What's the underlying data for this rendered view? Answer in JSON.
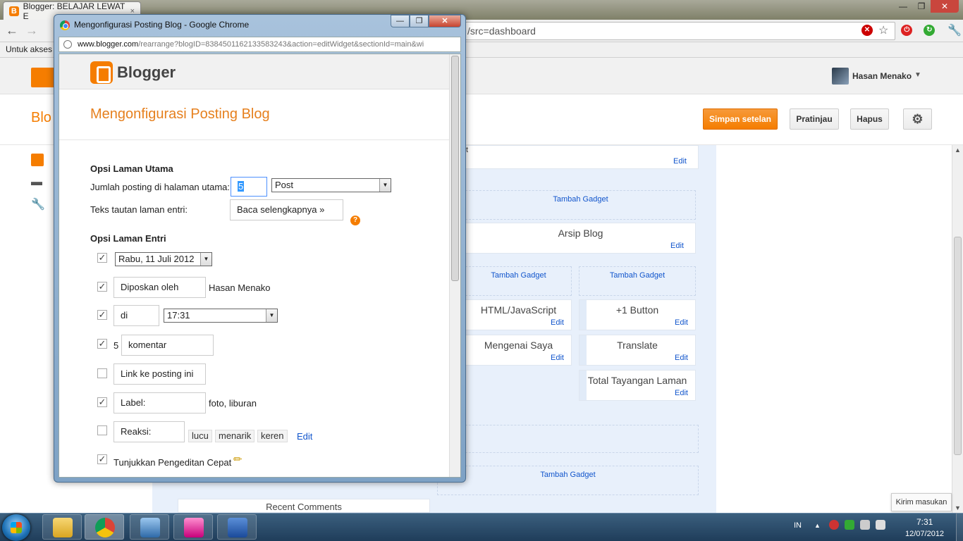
{
  "background_browser": {
    "tab_title": "Blogger: BELAJAR LEWAT E",
    "tab_close": "×",
    "address_suffix": "/src=dashboard",
    "bookmark_text": "Untuk akses",
    "user_name": "Hasan Menako",
    "blog_title_partial": "Blo",
    "buttons": {
      "save": "Simpan setelan",
      "preview": "Pratinjau",
      "delete": "Hapus"
    },
    "feedback": "Kirim masukan",
    "colors": {
      "accent": "#f57d00",
      "link": "#1155cc"
    }
  },
  "layout_gadgets": {
    "add_gadget_label": "Tambah Gadget",
    "edit_label": "Edit",
    "gadgets": [
      {
        "name": "Arsip Blog"
      },
      {
        "name": "HTML/JavaScript"
      },
      {
        "name": "+1 Button"
      },
      {
        "name": "Mengenai Saya"
      },
      {
        "name": "Translate"
      },
      {
        "name": "Total Tayangan Laman"
      },
      {
        "name": "Recent Comments"
      }
    ],
    "top_fragment": "t"
  },
  "popup": {
    "window_title": "Mengonfigurasi Posting Blog - Google Chrome",
    "url_host": "www.blogger.com",
    "url_path": "/rearrange?blogID=8384501162133583243&action=editWidget&sectionId=main&wi",
    "brand": "Blogger",
    "page_title": "Mengonfigurasi Posting Blog",
    "main_page_options": {
      "heading": "Opsi Laman Utama",
      "posts_label": "Jumlah posting di halaman utama:",
      "posts_value": "5",
      "posts_unit": "Post",
      "link_label": "Teks tautan laman entri:",
      "link_value": "Baca selengkapnya »",
      "help": "?"
    },
    "entry_page_options": {
      "heading": "Opsi Laman Entri",
      "date_value": "Rabu, 11 Juli 2012",
      "posted_by_value": "Diposkan oleh",
      "posted_by_name": "Hasan Menako",
      "at_value": "di",
      "time_value": "17:31",
      "comments_count": "5",
      "comments_value": "komentar",
      "post_link_value": "Link ke posting ini",
      "labels_value": "Label:",
      "labels_example": "foto, liburan",
      "reactions_value": "Reaksi:",
      "reactions_tags": [
        "lucu",
        "menarik",
        "keren"
      ],
      "reactions_edit": "Edit",
      "quick_edit_label": "Tunjukkan Pengeditan Cepat",
      "check_mark": "✓"
    }
  },
  "taskbar": {
    "lang": "IN",
    "time": "7:31",
    "date": "12/07/2012"
  }
}
